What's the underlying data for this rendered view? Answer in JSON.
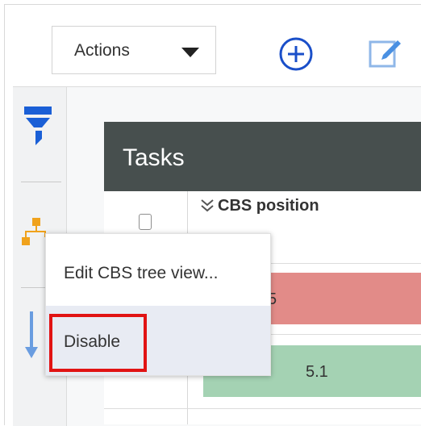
{
  "toolbar": {
    "actions_label": "Actions",
    "add_icon": "plus-circle-icon",
    "edit_icon": "edit-icon"
  },
  "rail": {
    "icons": [
      "filter-icon",
      "hierarchy-icon",
      "sort-icon"
    ]
  },
  "grid": {
    "title": "Tasks",
    "columns": [
      {
        "label": "CBS position"
      }
    ],
    "rows": [
      {
        "cbs_position": "5",
        "color": "#e28b88"
      },
      {
        "cbs_position": "5.1",
        "color": "#a4d2b3"
      }
    ]
  },
  "context_menu": {
    "items": [
      {
        "label": "Edit CBS tree view..."
      },
      {
        "label": "Disable",
        "highlighted": true
      }
    ]
  },
  "colors": {
    "header_bg": "#474f4e",
    "accent_blue": "#1a73e8",
    "highlight_red": "#e11313"
  }
}
